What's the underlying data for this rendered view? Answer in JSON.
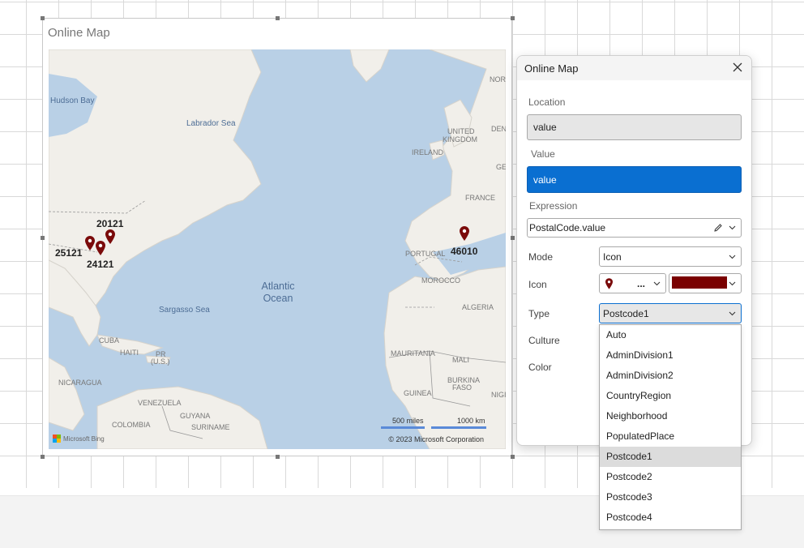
{
  "map": {
    "title": "Online Map",
    "labels": {
      "hudson_bay": "Hudson Bay",
      "labrador_sea": "Labrador Sea",
      "atlantic_1": "Atlantic",
      "atlantic_2": "Ocean",
      "sargasso": "Sargasso Sea",
      "united_kingdom_1": "UNITED",
      "united_kingdom_2": "KINGDOM",
      "ireland": "IRELAND",
      "france": "FRANCE",
      "portugal": "PORTUGAL",
      "morocco": "MOROCCO",
      "algeria": "ALGERIA",
      "mauritania": "MAURITANIA",
      "mali": "MALI",
      "burkina_1": "BURKINA",
      "burkina_2": "FASO",
      "guinea": "GUINEA",
      "nig": "NIGI",
      "nor": "NOR",
      "den": "DENI",
      "ger": "GEI",
      "cuba": "CUBA",
      "haiti": "HAITI",
      "pr_1": "PR",
      "pr_2": "(U.S.)",
      "nicaragua": "NICARAGUA",
      "venezuela": "VENEZUELA",
      "guyana": "GUYANA",
      "suriname": "SURINAME",
      "colombia": "COLOMBIA"
    },
    "pins": [
      "20121",
      "25121",
      "24121",
      "46010"
    ],
    "scale_miles": "500 miles",
    "scale_km": "1000 km",
    "attribution": "Microsoft Bing",
    "copyright": "© 2023 Microsoft Corporation",
    "pin_color": "#7a0a0a"
  },
  "dialog": {
    "title": "Online Map",
    "location_label": "Location",
    "location_value": "value",
    "value_label": "Value",
    "value_value": "value",
    "expression_label": "Expression",
    "expression_value": "PostalCode.value",
    "mode_label": "Mode",
    "mode_value": "Icon",
    "icon_label": "Icon",
    "icon_value": "...",
    "icon_color": "#7a0000",
    "type_label": "Type",
    "type_value": "Postcode1",
    "culture_label": "Culture",
    "color_label": "Color",
    "type_options": [
      "Auto",
      "AdminDivision1",
      "AdminDivision2",
      "CountryRegion",
      "Neighborhood",
      "PopulatedPlace",
      "Postcode1",
      "Postcode2",
      "Postcode3",
      "Postcode4"
    ],
    "selected_option": "Postcode1"
  }
}
